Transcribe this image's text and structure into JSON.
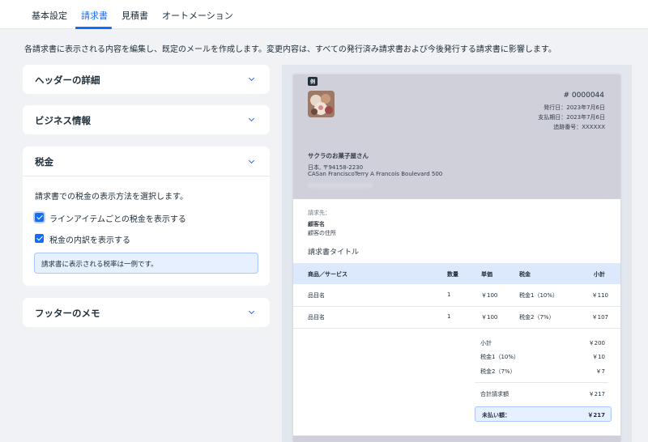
{
  "tabs": [
    {
      "label": "基本設定"
    },
    {
      "label": "請求書",
      "active": true
    },
    {
      "label": "見積書"
    },
    {
      "label": "オートメーション"
    }
  ],
  "description": "各請求書に表示される内容を編集し、既定のメールを作成します。変更内容は、すべての発行済み請求書および今後発行する請求書に影響します。",
  "sections": {
    "header": {
      "title": "ヘッダーの詳細",
      "expanded": false
    },
    "business": {
      "title": "ビジネス情報",
      "expanded": false
    },
    "tax": {
      "title": "税金",
      "expanded": true,
      "description": "請求書での税金の表示方法を選択します。",
      "option1": {
        "label": "ラインアイテムごとの税金を表示する",
        "checked": true
      },
      "option2": {
        "label": "税金の内訳を表示する",
        "checked": true
      },
      "note": "請求書に表示される税率は一例です。"
    },
    "footer": {
      "title": "フッターのメモ",
      "expanded": false
    }
  },
  "preview": {
    "example_badge": "例",
    "invoice_number": "# 0000044",
    "issue_date": "発行日：2023年7月6日",
    "due_date": "支払期日：2023年7月6日",
    "tracking": "追跡番号：XXXXXX",
    "business_name": "サクラのお菓子屋さん",
    "address_line1": "日本, 〒94158-2230",
    "address_line2": "CASan FranciscoTerry A Francois Boulevard 500",
    "bill_to_label": "請求先：",
    "customer_name": "顧客名",
    "customer_address": "顧客の住所",
    "invoice_title": "請求書タイトル",
    "table": {
      "headers": {
        "item": "商品／サービス",
        "qty": "数量",
        "price": "単価",
        "tax": "税金",
        "subtotal": "小計"
      },
      "rows": [
        {
          "item": "品目名",
          "qty": "1",
          "price": "￥100",
          "tax": "税金1（10%）",
          "subtotal": "￥110"
        },
        {
          "item": "品目名",
          "qty": "1",
          "price": "￥100",
          "tax": "税金2（7%）",
          "subtotal": "￥107"
        }
      ]
    },
    "totals": {
      "subtotal_label": "小計",
      "subtotal": "￥200",
      "tax1_label": "税金1（10%）",
      "tax1": "￥10",
      "tax2_label": "税金2（7%）",
      "tax2": "￥7",
      "total_label": "合計請求額",
      "total": "￥217",
      "due_label": "未払い額：",
      "due": "￥217"
    }
  },
  "colors": {
    "accent": "#116dff",
    "header_band": "#cfd0d9",
    "table_header": "#dce8fb",
    "note_bg": "#e7f0ff"
  }
}
